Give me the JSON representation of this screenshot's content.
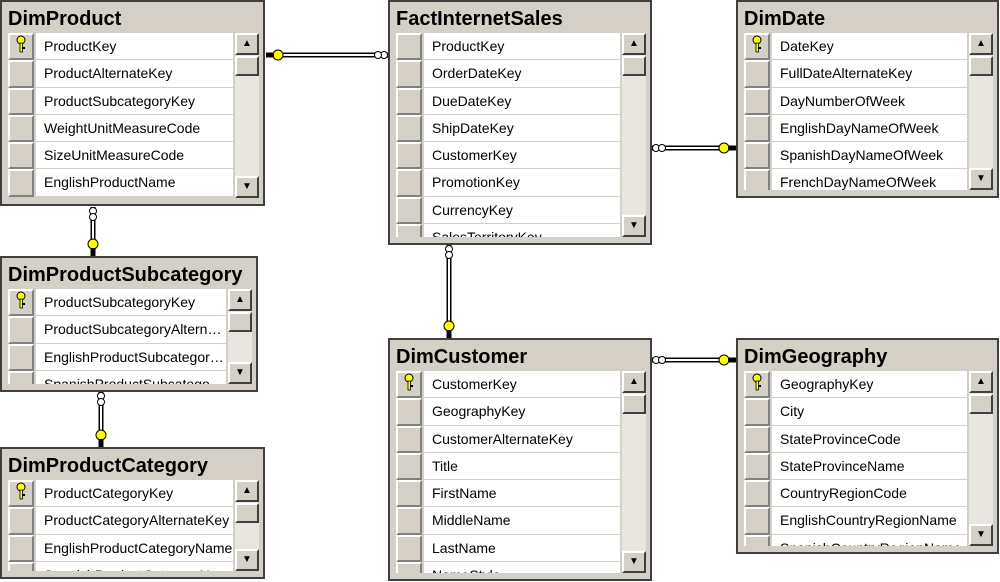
{
  "colors": {
    "key": "#ffff00",
    "panel": "#d4d0c8"
  },
  "tables": [
    {
      "name": "DimProduct",
      "columns": [
        "ProductKey",
        "ProductAlternateKey",
        "ProductSubcategoryKey",
        "WeightUnitMeasureCode",
        "SizeUnitMeasureCode",
        "EnglishProductName"
      ],
      "primary_key": "ProductKey"
    },
    {
      "name": "FactInternetSales",
      "columns": [
        "ProductKey",
        "OrderDateKey",
        "DueDateKey",
        "ShipDateKey",
        "CustomerKey",
        "PromotionKey",
        "CurrencyKey",
        "SalesTerritoryKey"
      ],
      "primary_key": ""
    },
    {
      "name": "DimDate",
      "columns": [
        "DateKey",
        "FullDateAlternateKey",
        "DayNumberOfWeek",
        "EnglishDayNameOfWeek",
        "SpanishDayNameOfWeek",
        "FrenchDayNameOfWeek"
      ],
      "primary_key": "DateKey"
    },
    {
      "name": "DimProductSubcategory",
      "columns": [
        "ProductSubcategoryKey",
        "ProductSubcategoryAlternateKey",
        "EnglishProductSubcategoryName",
        "SpanishProductSubcategoryName"
      ],
      "primary_key": "ProductSubcategoryKey"
    },
    {
      "name": "DimProductCategory",
      "columns": [
        "ProductCategoryKey",
        "ProductCategoryAlternateKey",
        "EnglishProductCategoryName",
        "SpanishProductCategoryName"
      ],
      "primary_key": "ProductCategoryKey"
    },
    {
      "name": "DimCustomer",
      "columns": [
        "CustomerKey",
        "GeographyKey",
        "CustomerAlternateKey",
        "Title",
        "FirstName",
        "MiddleName",
        "LastName",
        "NameStyle"
      ],
      "primary_key": "CustomerKey"
    },
    {
      "name": "DimGeography",
      "columns": [
        "GeographyKey",
        "City",
        "StateProvinceCode",
        "StateProvinceName",
        "CountryRegionCode",
        "EnglishCountryRegionName",
        "SpanishCountryRegionName"
      ],
      "primary_key": "GeographyKey"
    }
  ],
  "relationships": [
    {
      "one": "DimProduct",
      "many": "FactInternetSales"
    },
    {
      "one": "DimDate",
      "many": "FactInternetSales"
    },
    {
      "one": "DimCustomer",
      "many": "FactInternetSales"
    },
    {
      "one": "DimGeography",
      "many": "DimCustomer"
    },
    {
      "one": "DimProductSubcategory",
      "many": "DimProduct"
    },
    {
      "one": "DimProductCategory",
      "many": "DimProductSubcategory"
    }
  ]
}
